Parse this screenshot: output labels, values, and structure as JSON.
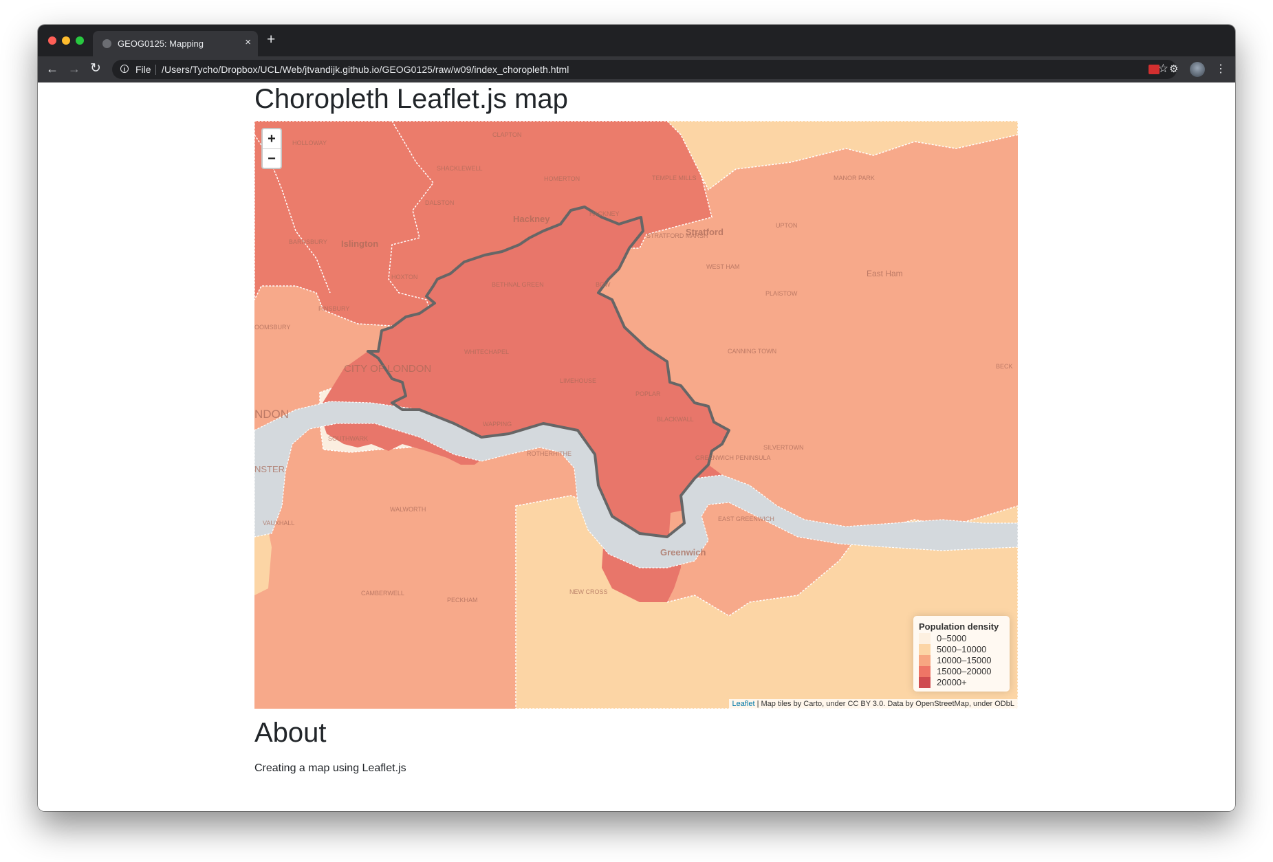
{
  "browser": {
    "tab_title": "GEOG0125: Mapping",
    "tab_close": "×",
    "new_tab": "+",
    "file_label": "File",
    "url": "/Users/Tycho/Dropbox/UCL/Web/jtvandijk.github.io/GEOG0125/raw/w09/index_choropleth.html"
  },
  "page": {
    "title": "Choropleth Leaflet.js map",
    "about_heading": "About",
    "about_text": "Creating a map using Leaflet.js"
  },
  "map": {
    "zoom_in": "+",
    "zoom_out": "−",
    "legend": {
      "title": "Population density",
      "items": [
        {
          "label": "0–5000",
          "color": "#fdf0e0"
        },
        {
          "label": "5000–10000",
          "color": "#fcd5a5"
        },
        {
          "label": "10000–15000",
          "color": "#f7a681"
        },
        {
          "label": "15000–20000",
          "color": "#ee7566"
        },
        {
          "label": "20000+",
          "color": "#cf4b4f"
        }
      ]
    },
    "attribution": {
      "link": "Leaflet",
      "text": " | Map tiles by Carto, under CC BY 3.0. Data by OpenStreetMap, under ODbL"
    },
    "place_labels": {
      "holloway": "HOLLOWAY",
      "clapton": "CLAPTON",
      "shacklewell": "SHACKLEWELL",
      "homerton": "HOMERTON",
      "temple_mills": "TEMPLE MILLS",
      "manor_park": "MANOR PARK",
      "dalston": "DALSTON",
      "hackney": "Hackney",
      "hackney_wick": "HACKNEY",
      "barnsbury": "BARNSBURY",
      "islington": "Islington",
      "stratford_marsh": "STRATFORD MARSH",
      "stratford": "Stratford",
      "upton": "UPTON",
      "hoxton": "HOXTON",
      "west_ham": "WEST HAM",
      "bethnal_green": "BETHNAL GREEN",
      "bow": "BOW",
      "east_ham": "East Ham",
      "plaistow": "PLAISTOW",
      "finsbury": "FINSBURY",
      "bloomsbury": "OOMSBURY",
      "whitechapel": "WHITECHAPEL",
      "canning_town": "CANNING TOWN",
      "city_of_london": "CITY OF LONDON",
      "beck": "BECK",
      "limehouse": "LIMEHOUSE",
      "poplar": "POPLAR",
      "london": "NDON",
      "blackwall": "BLACKWALL",
      "wapping": "WAPPING",
      "southwark": "SOUTHWARK",
      "silvertown": "SILVERTOWN",
      "rotherhithe": "ROTHERHITHE",
      "greenwich_peninsula": "GREENWICH PENINSULA",
      "westminster": "NSTER",
      "walworth": "WALWORTH",
      "east_greenwich": "EAST GREENWICH",
      "vauxhall": "VAUXHALL",
      "greenwich": "Greenwich",
      "new_cross": "NEW CROSS",
      "camberwell": "CAMBERWELL",
      "peckham": "PECKHAM"
    }
  }
}
